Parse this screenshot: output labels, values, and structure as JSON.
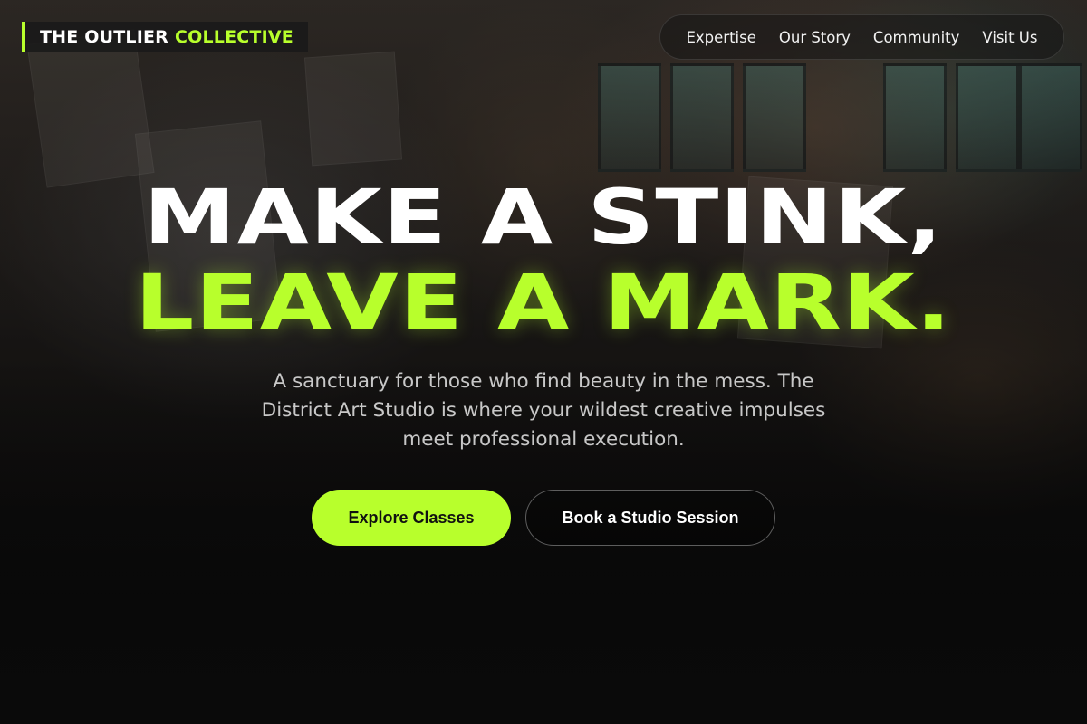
{
  "brand": {
    "name_part1": "THE OUTLIER",
    "name_part2": "COLLECTIVE",
    "accent_color": "#b8ff2c"
  },
  "nav": {
    "items": [
      {
        "label": "Expertise"
      },
      {
        "label": "Our Story"
      },
      {
        "label": "Community"
      },
      {
        "label": "Visit Us"
      }
    ]
  },
  "hero": {
    "headline_line1": "MAKE A STINK,",
    "headline_line2": "LEAVE A MARK.",
    "subheading": "A sanctuary for those who find beauty in the mess. The District Art Studio is where your wildest creative impulses meet professional execution.",
    "primary_cta": "Explore Classes",
    "secondary_cta": "Book a Studio Session"
  }
}
